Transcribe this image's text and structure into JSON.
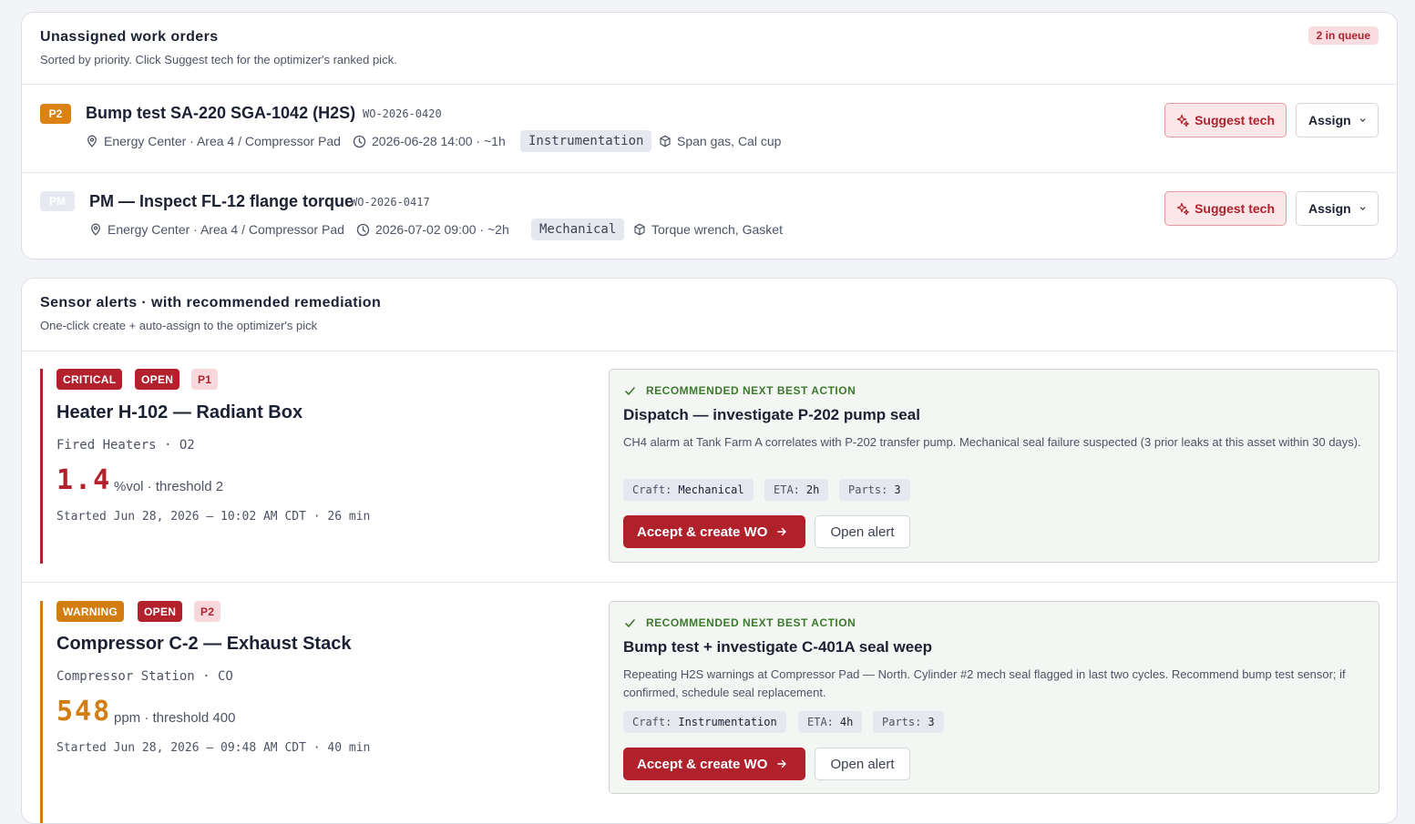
{
  "colors": {
    "brand_red": "#b0212c",
    "warning_orange": "#d27d10",
    "critical_red": "#b3212d",
    "success_green": "#3d7a2e"
  },
  "work_orders_card": {
    "title": "Unassigned work orders",
    "subtitle": "Sorted by priority. Click Suggest tech for the optimizer's ranked pick.",
    "queue_badge": "2 in queue",
    "items": [
      {
        "priority": "P2",
        "title": "Bump test SA-220 SGA-1042 (H2S)",
        "id": "WO-2026-0420",
        "location": "Energy Center · Area 4 / Compressor Pad",
        "schedule": "2026-06-28 14:00 · ~1h",
        "craft": "Instrumentation",
        "parts": "Span gas, Cal cup",
        "suggest_label": "Suggest tech",
        "assign_label": "Assign",
        "icons": [
          "location-pin-icon",
          "clock-icon",
          "package-icon",
          "sparkle-icon",
          "chevron-down-icon"
        ]
      },
      {
        "priority": "PM",
        "title": "PM — Inspect FL-12 flange torque",
        "id": "WO-2026-0417",
        "location": "Energy Center · Area 4 / Compressor Pad",
        "schedule": "2026-07-02 09:00 · ~2h",
        "craft": "Mechanical",
        "parts": "Torque wrench, Gasket",
        "suggest_label": "Suggest tech",
        "assign_label": "Assign"
      }
    ]
  },
  "alerts_card": {
    "title": "Sensor alerts · with recommended remediation",
    "subtitle": "One-click create + auto-assign to the optimizer's pick",
    "alerts": [
      {
        "severity": "CRITICAL",
        "status": "OPEN",
        "priority": "P1",
        "asset": "Heater H-102 — Radiant Box",
        "sensor": "Fired Heaters · O2",
        "value": "1.4",
        "unit_threshold": "%vol · threshold 2",
        "started": "Started Jun 28, 2026 — 10:02 AM CDT · 26 min",
        "accent": "#b3212d",
        "nba": {
          "label": "RECOMMENDED NEXT BEST ACTION",
          "title": "Dispatch — investigate P-202 pump seal",
          "description": "CH4 alarm at Tank Farm A correlates with P-202 transfer pump. Mechanical seal failure suspected (3 prior leaks at this asset within 30 days).",
          "chips": [
            {
              "key": "Craft:",
              "value": "Mechanical"
            },
            {
              "key": "ETA:",
              "value": "2h"
            },
            {
              "key": "Parts:",
              "value": "3"
            }
          ],
          "accept_label": "Accept & create WO",
          "open_label": "Open alert"
        }
      },
      {
        "severity": "WARNING",
        "status": "OPEN",
        "priority": "P2",
        "asset": "Compressor C-2 — Exhaust Stack",
        "sensor": "Compressor Station · CO",
        "value": "548",
        "unit_threshold": "ppm · threshold 400",
        "started": "Started Jun 28, 2026 — 09:48 AM CDT · 40 min",
        "accent": "#d27d10",
        "nba": {
          "label": "RECOMMENDED NEXT BEST ACTION",
          "title": "Bump test + investigate C-401A seal weep",
          "description": "Repeating H2S warnings at Compressor Pad — North. Cylinder #2 mech seal flagged in last two cycles. Recommend bump test sensor; if confirmed, schedule seal replacement.",
          "chips": [
            {
              "key": "Craft:",
              "value": "Instrumentation"
            },
            {
              "key": "ETA:",
              "value": "4h"
            },
            {
              "key": "Parts:",
              "value": "3"
            }
          ],
          "accept_label": "Accept & create WO",
          "open_label": "Open alert"
        }
      }
    ]
  }
}
